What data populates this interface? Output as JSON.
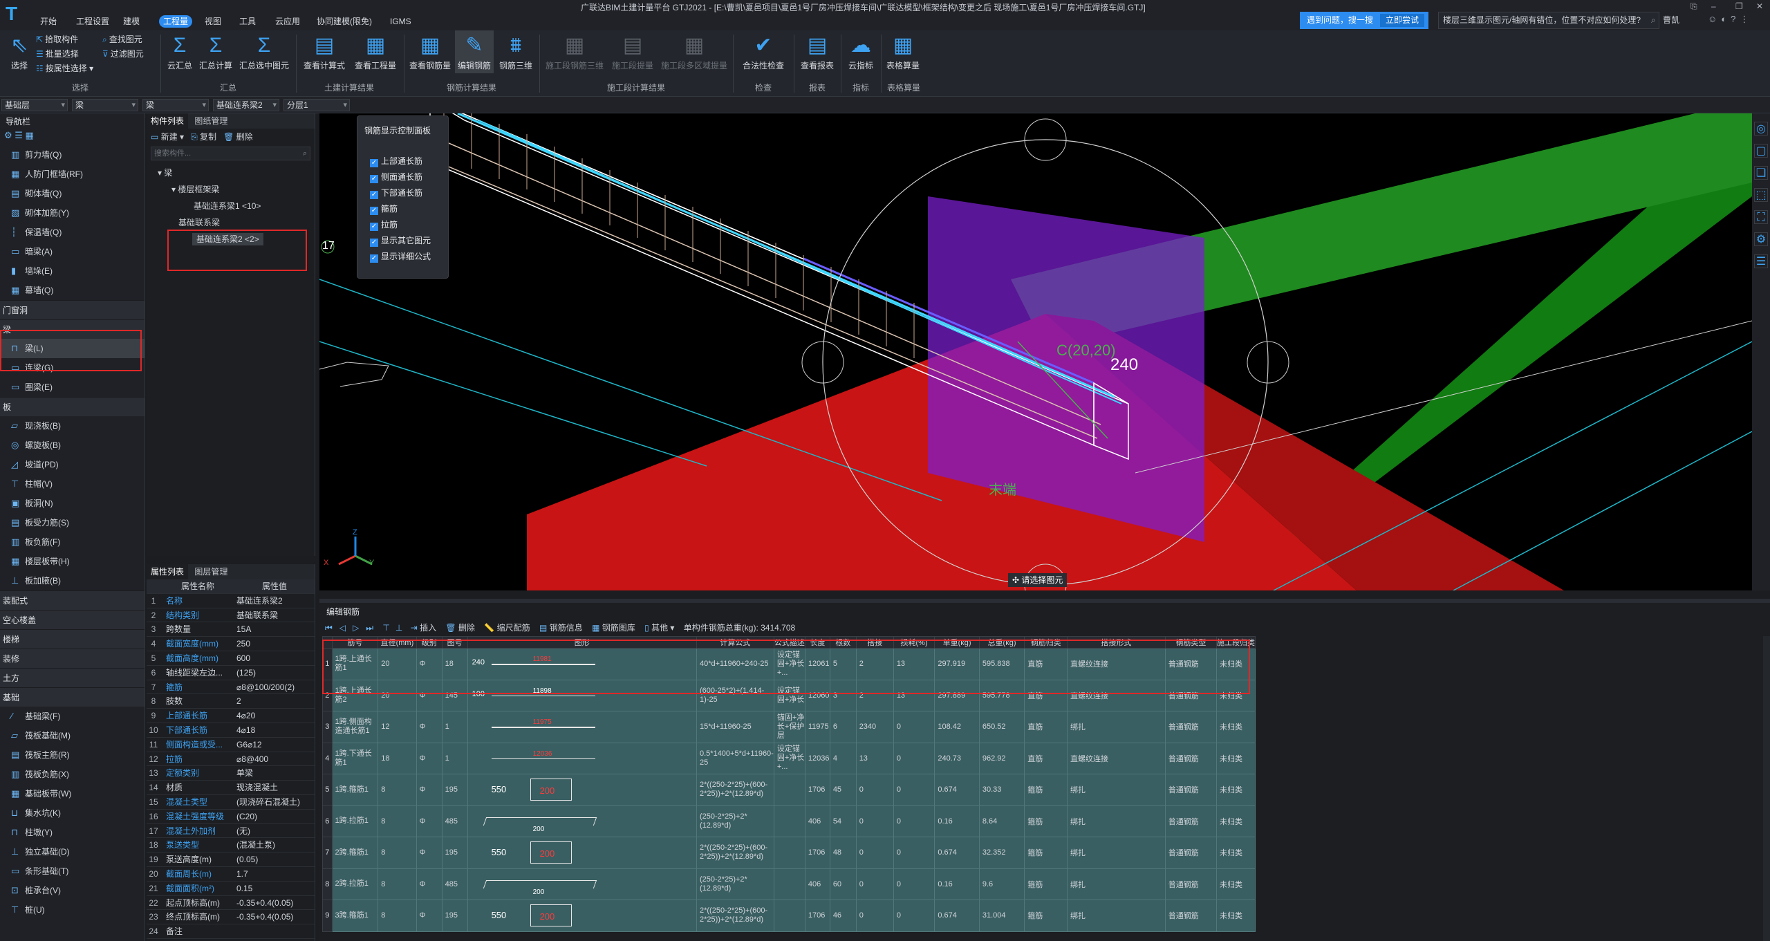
{
  "window": {
    "title": "广联达BIM土建计量平台 GTJ2021 - [E:\\曹凯\\夏邑项目\\夏邑1号厂房冲压焊接车间\\广联达模型\\框架结构\\变更之后 现场施工\\夏邑1号厂房冲压焊接车间.GTJ]",
    "help_prompt": "遇到问题，搜一搜",
    "help_button": "立即尝试",
    "question_text": "楼层三维显示图元/轴网有错位，位置不对应如何处理?",
    "user": "曹凯",
    "controls": [
      "⎘",
      "–",
      "❐",
      "✕"
    ]
  },
  "menu_tabs": [
    "开始",
    "工程设置",
    "建模",
    "工程量",
    "视图",
    "工具",
    "云应用",
    "协同建模(限免)",
    "IGMS"
  ],
  "active_tab": "工程量",
  "ribbon": {
    "select_big": "选择",
    "select_small": [
      "拾取构件",
      "批量选择",
      "按属性选择"
    ],
    "select_small2": [
      "查找图元",
      "过滤图元"
    ],
    "summary_btns": [
      "云汇总",
      "汇总计算",
      "汇总选中图元"
    ],
    "civil_btns": [
      "查看计算式",
      "查看工程量"
    ],
    "rebar_btns": [
      "查看钢筋量",
      "编辑钢筋",
      "钢筋三维"
    ],
    "phase_btns": [
      "施工段钢筋三维",
      "施工段提量",
      "施工段多区域提量"
    ],
    "check_btns": [
      "合法性检查"
    ],
    "report_btns": [
      "查看报表"
    ],
    "index_btns": [
      "云指标"
    ],
    "table_btns": [
      "表格算量"
    ],
    "groups": [
      "选择",
      "汇总",
      "土建计算结果",
      "钢筋计算结果",
      "施工段计算结果",
      "检查",
      "报表",
      "指标",
      "表格算量"
    ]
  },
  "filters": [
    "基础层",
    "梁",
    "梁",
    "基础连系梁2",
    "分层1"
  ],
  "navbar": {
    "title": "导航栏",
    "items_top": [
      {
        "label": "剪力墙(Q)",
        "icon": "▥"
      },
      {
        "label": "人防门框墙(RF)",
        "icon": "▦"
      },
      {
        "label": "砌体墙(Q)",
        "icon": "▤"
      },
      {
        "label": "砌体加筋(Y)",
        "icon": "▧"
      },
      {
        "label": "保温墙(Q)",
        "icon": "┆"
      },
      {
        "label": "暗梁(A)",
        "icon": "▭"
      },
      {
        "label": "墙垛(E)",
        "icon": "▮"
      },
      {
        "label": "幕墙(Q)",
        "icon": "▦"
      }
    ],
    "cat_door": "门窗洞",
    "cat_beam": "梁",
    "items_beam": [
      {
        "label": "梁(L)",
        "icon": "⊓"
      },
      {
        "label": "连梁(G)",
        "icon": "▭"
      },
      {
        "label": "圈梁(E)",
        "icon": "▭"
      }
    ],
    "cat_slab": "板",
    "items_slab": [
      {
        "label": "现浇板(B)",
        "icon": "▱"
      },
      {
        "label": "螺旋板(B)",
        "icon": "◎"
      },
      {
        "label": "坡道(PD)",
        "icon": "◿"
      },
      {
        "label": "柱帽(V)",
        "icon": "⊤"
      },
      {
        "label": "板洞(N)",
        "icon": "▣"
      },
      {
        "label": "板受力筋(S)",
        "icon": "▤"
      },
      {
        "label": "板负筋(F)",
        "icon": "▥"
      },
      {
        "label": "楼层板带(H)",
        "icon": "▦"
      },
      {
        "label": "板加腋(B)",
        "icon": "⊥"
      }
    ],
    "cats_more": [
      "装配式",
      "空心楼盖",
      "楼梯",
      "装修",
      "土方",
      "基础"
    ],
    "items_found": [
      {
        "label": "基础梁(F)",
        "icon": "⁄"
      },
      {
        "label": "筏板基础(M)",
        "icon": "▱"
      },
      {
        "label": "筏板主筋(R)",
        "icon": "▤"
      },
      {
        "label": "筏板负筋(X)",
        "icon": "▥"
      },
      {
        "label": "基础板带(W)",
        "icon": "▦"
      },
      {
        "label": "集水坑(K)",
        "icon": "⊔"
      },
      {
        "label": "柱墩(Y)",
        "icon": "⊓"
      },
      {
        "label": "独立基础(D)",
        "icon": "⊥"
      },
      {
        "label": "条形基础(T)",
        "icon": "▭"
      },
      {
        "label": "桩承台(V)",
        "icon": "⊡"
      },
      {
        "label": "桩(U)",
        "icon": "⊤"
      }
    ]
  },
  "component_list": {
    "tabs": [
      "构件列表",
      "图纸管理"
    ],
    "actions": [
      "新建",
      "复制",
      "删除"
    ],
    "search_placeholder": "搜索构件...",
    "tree": {
      "root": "梁",
      "group1": "楼层框架梁",
      "item1": "基础连系梁1 <10>",
      "group2": "基础联系梁",
      "item2": "基础连系梁2 <2>"
    }
  },
  "properties": {
    "tabs": [
      "属性列表",
      "图层管理"
    ],
    "header": [
      "属性名称",
      "属性值"
    ],
    "rows": [
      {
        "n": "1",
        "k": "名称",
        "v": "基础连系梁2",
        "blue": true
      },
      {
        "n": "2",
        "k": "结构类别",
        "v": "基础联系梁",
        "blue": true
      },
      {
        "n": "3",
        "k": "跨数量",
        "v": "15A",
        "blue": false
      },
      {
        "n": "4",
        "k": "截面宽度(mm)",
        "v": "250",
        "blue": true
      },
      {
        "n": "5",
        "k": "截面高度(mm)",
        "v": "600",
        "blue": true
      },
      {
        "n": "6",
        "k": "轴线距梁左边...",
        "v": "(125)",
        "blue": false
      },
      {
        "n": "7",
        "k": "箍筋",
        "v": "⌀8@100/200(2)",
        "blue": true
      },
      {
        "n": "8",
        "k": "肢数",
        "v": "2",
        "blue": false
      },
      {
        "n": "9",
        "k": "上部通长筋",
        "v": "4⌀20",
        "blue": true
      },
      {
        "n": "10",
        "k": "下部通长筋",
        "v": "4⌀18",
        "blue": true
      },
      {
        "n": "11",
        "k": "侧面构造或受...",
        "v": "G6⌀12",
        "blue": true
      },
      {
        "n": "12",
        "k": "拉筋",
        "v": "⌀8@400",
        "blue": true
      },
      {
        "n": "13",
        "k": "定额类别",
        "v": "单梁",
        "blue": true
      },
      {
        "n": "14",
        "k": "材质",
        "v": "现浇混凝土",
        "blue": false
      },
      {
        "n": "15",
        "k": "混凝土类型",
        "v": "(现浇碎石混凝土)",
        "blue": true
      },
      {
        "n": "16",
        "k": "混凝土强度等级",
        "v": "(C20)",
        "blue": true
      },
      {
        "n": "17",
        "k": "混凝土外加剂",
        "v": "(无)",
        "blue": true
      },
      {
        "n": "18",
        "k": "泵送类型",
        "v": "(混凝土泵)",
        "blue": true
      },
      {
        "n": "19",
        "k": "泵送高度(m)",
        "v": "(0.05)",
        "blue": false
      },
      {
        "n": "20",
        "k": "截面周长(m)",
        "v": "1.7",
        "blue": true
      },
      {
        "n": "21",
        "k": "截面面积(m²)",
        "v": "0.15",
        "blue": true
      },
      {
        "n": "22",
        "k": "起点顶标高(m)",
        "v": "-0.35+0.4(0.05)",
        "blue": false
      },
      {
        "n": "23",
        "k": "终点顶标高(m)",
        "v": "-0.35+0.4(0.05)",
        "blue": false
      },
      {
        "n": "24",
        "k": "备注",
        "v": "",
        "blue": false
      }
    ]
  },
  "rebar_panel": {
    "title": "钢筋显示控制面板",
    "options": [
      "上部通长筋",
      "侧面通长筋",
      "下部通长筋",
      "箍筋",
      "拉筋",
      "显示其它图元",
      "显示详细公式"
    ]
  },
  "viewport": {
    "axis_label": "17",
    "dim_text": "240",
    "dim_green": "C(20,20)",
    "end_label": "末端",
    "prompt": "请选择图元",
    "axes": [
      "X",
      "Y",
      "Z"
    ]
  },
  "edit_rebar": {
    "title": "编辑钢筋",
    "toolbar": [
      "插入",
      "删除",
      "缩尺配筋",
      "钢筋信息",
      "钢筋图库",
      "其他"
    ],
    "total": "单构件钢筋总重(kg): 3414.708",
    "columns": [
      "筋号",
      "直径(mm)",
      "级别",
      "图号",
      "图形",
      "计算公式",
      "公式描述",
      "长度",
      "根数",
      "搭接",
      "损耗(%)",
      "单重(kg)",
      "总重(kg)",
      "钢筋归类",
      "搭接形式",
      "钢筋类型",
      "施工段归类"
    ],
    "rows": [
      {
        "n": "1",
        "id": "1跨.上通长筋1",
        "d": "20",
        "g": "Φ",
        "fig": "18",
        "shape_l": "240",
        "shape_m": "11981",
        "formula": "40*d+11960+240-25",
        "desc": "设定锚固+净长+...",
        "len": "12061",
        "cnt": "5",
        "lap": "2",
        "loss": "13",
        "loss2": "0",
        "uw": "297.919",
        "tw": "595.838",
        "cls": "直筋",
        "lapf": "直螺纹连接",
        "type": "普通钢筋",
        "phase": "未归类"
      },
      {
        "n": "2",
        "id": "1跨.上通长筋2",
        "d": "20",
        "g": "Φ",
        "fig": "145",
        "shape_l": "100",
        "shape_m": "11898",
        "formula": "(600-25*2)+(1.414-1)-25",
        "desc": "设定锚固+净长",
        "len": "12060",
        "cnt": "3",
        "lap": "2",
        "loss": "13",
        "loss2": "0",
        "uw": "297.889",
        "tw": "595.778",
        "cls": "直筋",
        "lapf": "直螺纹连接",
        "type": "普通钢筋",
        "phase": "未归类"
      },
      {
        "n": "3",
        "id": "1跨.侧面构造通长筋1",
        "d": "12",
        "g": "Φ",
        "fig": "1",
        "shape_l": "",
        "shape_m": "11975",
        "formula": "15*d+11960-25",
        "desc": "锚固+净长+保护层",
        "len": "11975",
        "cnt": "6",
        "lap": "2340",
        "loss": "0",
        "loss2": "",
        "uw": "108.42",
        "tw": "650.52",
        "cls": "直筋",
        "lapf": "绑扎",
        "type": "普通钢筋",
        "phase": "未归类"
      },
      {
        "n": "4",
        "id": "1跨.下通长筋1",
        "d": "18",
        "g": "Φ",
        "fig": "1",
        "shape_l": "",
        "shape_m": "12036",
        "formula": "0.5*1400+5*d+11960-25",
        "desc": "设定锚固+净长+...",
        "len": "12036",
        "cnt": "4",
        "lap": "13",
        "loss": "0",
        "loss2": "",
        "uw": "240.73",
        "tw": "962.92",
        "cls": "直筋",
        "lapf": "直螺纹连接",
        "type": "普通钢筋",
        "phase": "未归类"
      },
      {
        "n": "5",
        "id": "1跨.箍筋1",
        "d": "8",
        "g": "Φ",
        "fig": "195",
        "shape_l": "550",
        "shape_m": "200",
        "formula": "2*((250-2*25)+(600-2*25))+2*(12.89*d)",
        "desc": "",
        "len": "1706",
        "cnt": "45",
        "lap": "0",
        "loss": "0",
        "loss2": "",
        "uw": "0.674",
        "tw": "30.33",
        "cls": "箍筋",
        "lapf": "绑扎",
        "type": "普通钢筋",
        "phase": "未归类"
      },
      {
        "n": "6",
        "id": "1跨.拉筋1",
        "d": "8",
        "g": "Φ",
        "fig": "485",
        "shape_l": "",
        "shape_m": "200",
        "formula": "(250-2*25)+2*(12.89*d)",
        "desc": "",
        "len": "406",
        "cnt": "54",
        "lap": "0",
        "loss": "0",
        "loss2": "",
        "uw": "0.16",
        "tw": "8.64",
        "cls": "箍筋",
        "lapf": "绑扎",
        "type": "普通钢筋",
        "phase": "未归类"
      },
      {
        "n": "7",
        "id": "2跨.箍筋1",
        "d": "8",
        "g": "Φ",
        "fig": "195",
        "shape_l": "550",
        "shape_m": "200",
        "formula": "2*((250-2*25)+(600-2*25))+2*(12.89*d)",
        "desc": "",
        "len": "1706",
        "cnt": "48",
        "lap": "0",
        "loss": "0",
        "loss2": "",
        "uw": "0.674",
        "tw": "32.352",
        "cls": "箍筋",
        "lapf": "绑扎",
        "type": "普通钢筋",
        "phase": "未归类"
      },
      {
        "n": "8",
        "id": "2跨.拉筋1",
        "d": "8",
        "g": "Φ",
        "fig": "485",
        "shape_l": "",
        "shape_m": "200",
        "formula": "(250-2*25)+2*(12.89*d)",
        "desc": "",
        "len": "406",
        "cnt": "60",
        "lap": "0",
        "loss": "0",
        "loss2": "",
        "uw": "0.16",
        "tw": "9.6",
        "cls": "箍筋",
        "lapf": "绑扎",
        "type": "普通钢筋",
        "phase": "未归类"
      },
      {
        "n": "9",
        "id": "3跨.箍筋1",
        "d": "8",
        "g": "Φ",
        "fig": "195",
        "shape_l": "550",
        "shape_m": "200",
        "formula": "2*((250-2*25)+(600-2*25))+2*(12.89*d)",
        "desc": "",
        "len": "1706",
        "cnt": "46",
        "lap": "0",
        "loss": "0",
        "loss2": "",
        "uw": "0.674",
        "tw": "31.004",
        "cls": "箍筋",
        "lapf": "绑扎",
        "type": "普通钢筋",
        "phase": "未归类"
      }
    ]
  },
  "colors": {
    "accent": "#2d8cf0",
    "highlight": "#e02828",
    "table_cell": "#3a5f62"
  }
}
